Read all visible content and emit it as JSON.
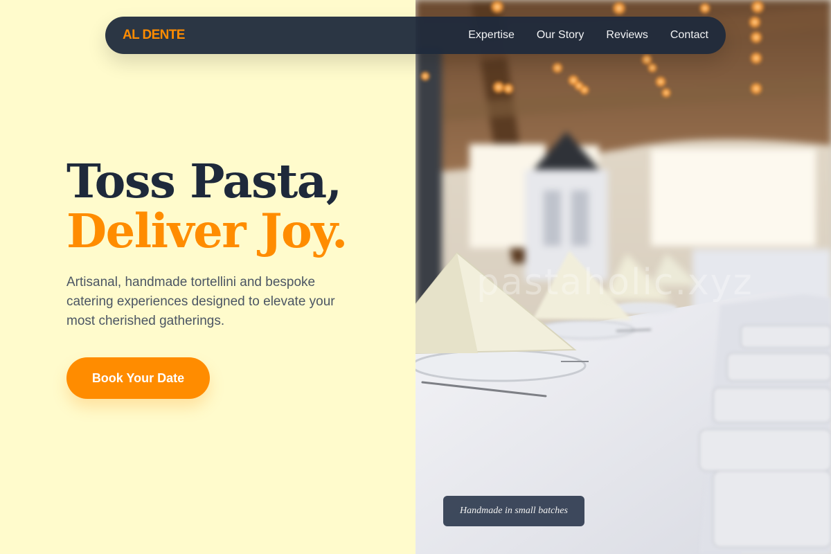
{
  "brand": {
    "logo": "AL DENTE",
    "accent_color": "#ff8c00",
    "dark_color": "#1e293b"
  },
  "nav": {
    "items": [
      {
        "label": "Expertise"
      },
      {
        "label": "Our Story"
      },
      {
        "label": "Reviews"
      },
      {
        "label": "Contact"
      }
    ]
  },
  "hero": {
    "title_line1": "Toss Pasta,",
    "title_line2": "Deliver Joy.",
    "subtitle": "Artisanal, handmade tortellini and bespoke catering experiences designed to elevate your most cherished gatherings.",
    "cta_label": "Book Your Date"
  },
  "photo": {
    "watermark": "pastaholic.xyz",
    "caption": "Handmade in small batches"
  }
}
